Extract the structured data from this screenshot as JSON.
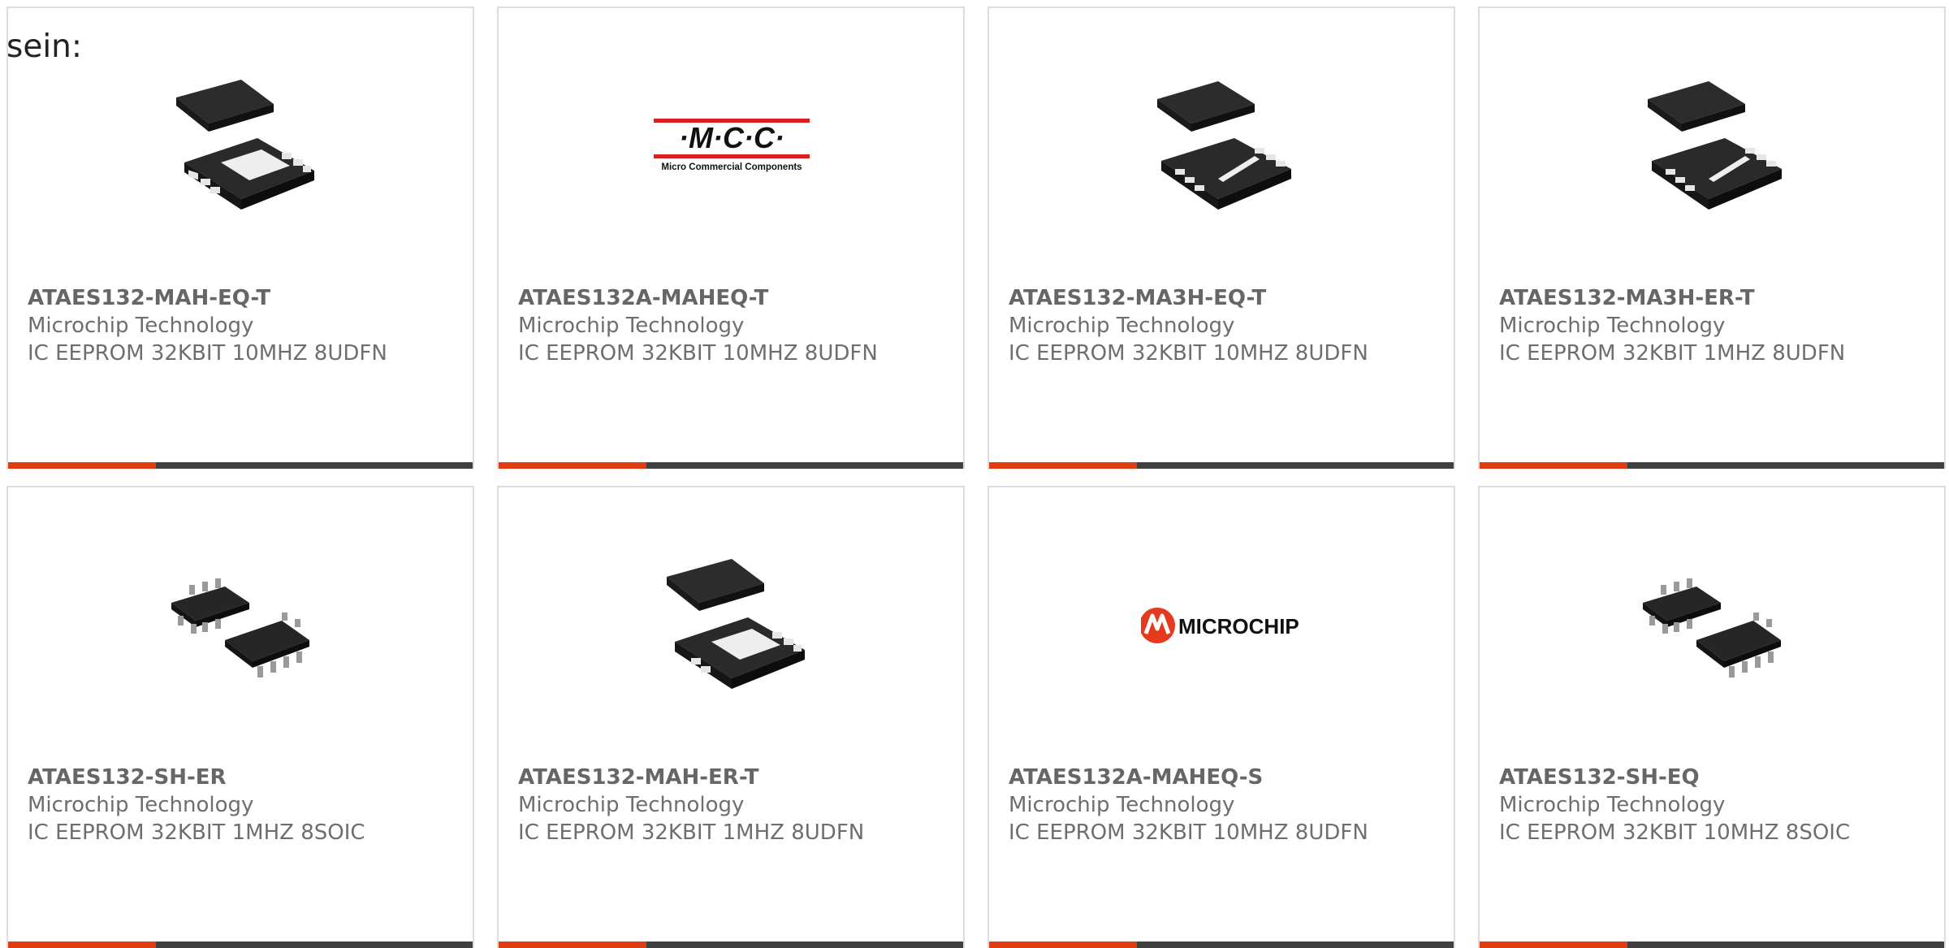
{
  "intro_text": "sein:",
  "colors": {
    "accent": "#e03c12",
    "bar_dark": "#404040",
    "card_border": "#dcdcdc",
    "text_gray": "#6e6e6e"
  },
  "cards": [
    {
      "part": "ATAES132-MAH-EQ-T",
      "manufacturer": "Microchip Technology",
      "description": "IC EEPROM 32KBIT 10MHZ 8UDFN",
      "image": "udfn-chip-two-views-icon"
    },
    {
      "part": "ATAES132A-MAHEQ-T",
      "manufacturer": "Microchip Technology",
      "description": "IC EEPROM 32KBIT 10MHZ 8UDFN",
      "image": "mcc-logo",
      "logo_text": "·M·C·C·",
      "logo_subtext": "Micro Commercial Components"
    },
    {
      "part": "ATAES132-MA3H-EQ-T",
      "manufacturer": "Microchip Technology",
      "description": "IC EEPROM 32KBIT 10MHZ 8UDFN",
      "image": "udfn-chip-bar-icon"
    },
    {
      "part": "ATAES132-MA3H-ER-T",
      "manufacturer": "Microchip Technology",
      "description": "IC EEPROM 32KBIT 1MHZ 8UDFN",
      "image": "udfn-chip-bar-icon"
    },
    {
      "part": "ATAES132-SH-ER",
      "manufacturer": "Microchip Technology",
      "description": "IC EEPROM 32KBIT 1MHZ 8SOIC",
      "image": "soic-chip-icon"
    },
    {
      "part": "ATAES132-MAH-ER-T",
      "manufacturer": "Microchip Technology",
      "description": "IC EEPROM 32KBIT 1MHZ 8UDFN",
      "image": "udfn-chip-two-views-icon"
    },
    {
      "part": "ATAES132A-MAHEQ-S",
      "manufacturer": "Microchip Technology",
      "description": "IC EEPROM 32KBIT 10MHZ 8UDFN",
      "image": "microchip-logo",
      "logo_text": "MICROCHIP"
    },
    {
      "part": "ATAES132-SH-EQ",
      "manufacturer": "Microchip Technology",
      "description": "IC EEPROM 32KBIT 10MHZ 8SOIC",
      "image": "soic-chip-icon"
    }
  ]
}
